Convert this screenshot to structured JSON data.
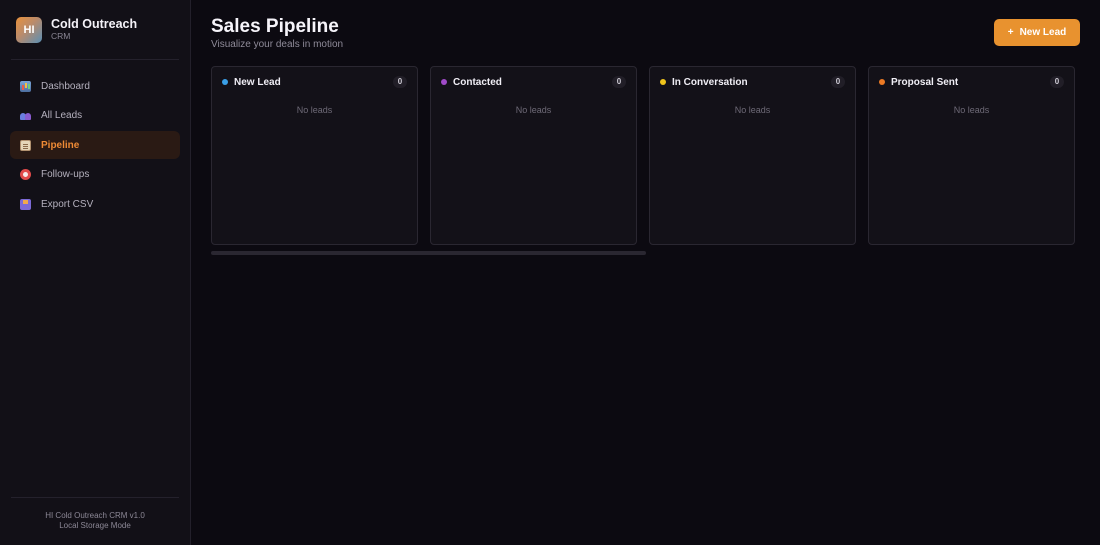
{
  "brand": {
    "logo_text": "HI",
    "title": "Cold Outreach",
    "subtitle": "CRM"
  },
  "sidebar": {
    "items": [
      {
        "label": "Dashboard",
        "icon": "chart-icon",
        "active": false
      },
      {
        "label": "All Leads",
        "icon": "users-icon",
        "active": false
      },
      {
        "label": "Pipeline",
        "icon": "clipboard-icon",
        "active": true
      },
      {
        "label": "Follow-ups",
        "icon": "alarm-clock-icon",
        "active": false
      },
      {
        "label": "Export CSV",
        "icon": "inbox-export-icon",
        "active": false
      }
    ],
    "footer_line1": "HI Cold Outreach CRM v1.0",
    "footer_line2": "Local Storage Mode"
  },
  "header": {
    "title": "Sales Pipeline",
    "subtitle": "Visualize your deals in motion",
    "new_lead_plus": "+",
    "new_lead_label": "New Lead"
  },
  "columns": [
    {
      "title": "New Lead",
      "count": "0",
      "empty": "No leads",
      "color": "#3aa0e8"
    },
    {
      "title": "Contacted",
      "count": "0",
      "empty": "No leads",
      "color": "#a04ac8"
    },
    {
      "title": "In Conversation",
      "count": "0",
      "empty": "No leads",
      "color": "#f0c41c"
    },
    {
      "title": "Proposal Sent",
      "count": "0",
      "empty": "No leads",
      "color": "#ec7a24"
    }
  ],
  "colors": {
    "accent": "#e8922f",
    "active_nav_bg": "#2a1a14",
    "background": "#0c0a11"
  }
}
